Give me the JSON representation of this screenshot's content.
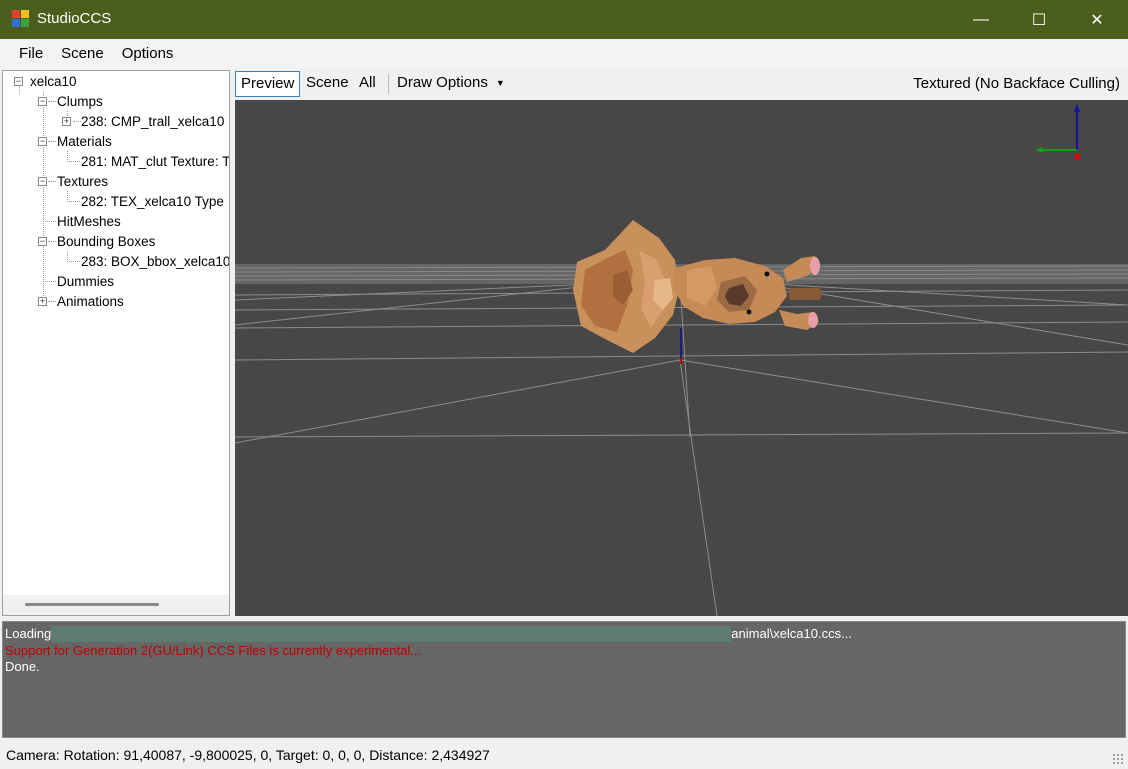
{
  "window": {
    "title": "StudioCCS",
    "controls": {
      "minimize": "—",
      "maximize": "☐",
      "close": "✕"
    }
  },
  "menu": [
    "File",
    "Scene",
    "Options"
  ],
  "tree": {
    "root": "xelca10",
    "clumps": "Clumps",
    "clump_item": "238: CMP_trall_xelca10",
    "materials": "Materials",
    "material_item": "281: MAT_clut Texture: T",
    "textures": "Textures",
    "texture_item": "282: TEX_xelca10  Type",
    "hitmeshes": "HitMeshes",
    "bounding_boxes": "Bounding Boxes",
    "bbox_item": "283: BOX_bbox_xelca10",
    "dummies": "Dummies",
    "animations": "Animations"
  },
  "viewport_toolbar": {
    "preview": "Preview",
    "scene": "Scene",
    "all": "All",
    "draw_options": "Draw Options",
    "render_mode": "Textured (No Backface Culling)"
  },
  "log": {
    "loading_prefix": "Loading",
    "loading_suffix": "animal\\xelca10.ccs...",
    "warning": "Support for Generation 2(GU/Link) CCS Files is currently experimental...",
    "done": "Done."
  },
  "status": "Camera: Rotation: 91,40087, -9,800025, 0, Target: 0, 0, 0, Distance: 2,434927",
  "colors": {
    "titlebar": "#4b5e1c",
    "viewport_bg": "#474747",
    "log_bg": "#666666",
    "log_warning": "#c00000",
    "model_body": "#c48a55"
  }
}
